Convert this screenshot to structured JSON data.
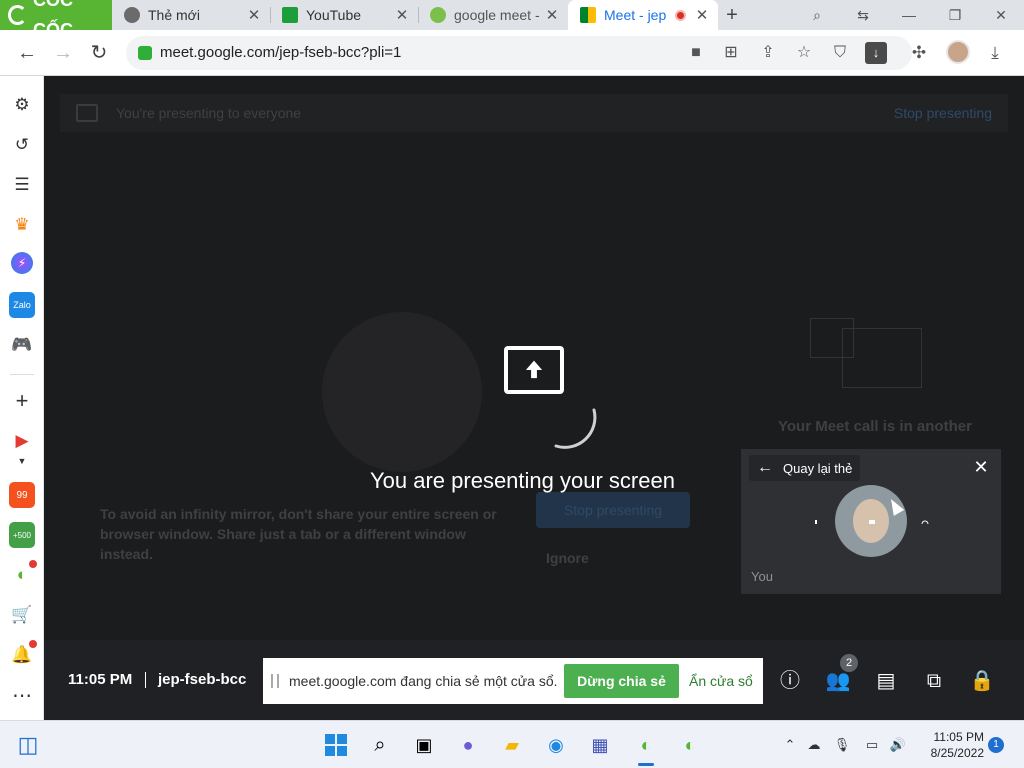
{
  "browser": {
    "brand": "CỐC CỐC",
    "tabs": [
      {
        "title": "Thẻ mới"
      },
      {
        "title": "YouTube"
      },
      {
        "title": "google meet -"
      },
      {
        "title": "Meet - jep",
        "active": true,
        "recording": true
      }
    ],
    "new_tab": "+",
    "url": "meet.google.com/jep-fseb-bcc?pli=1"
  },
  "meet": {
    "banner_text": "You're presenting to everyone",
    "banner_stop": "Stop presenting",
    "warning": "To avoid an infinity mirror, don't share your entire screen or browser window. Share just a tab or a different window instead.",
    "ghost_stop": "Stop presenting",
    "ghost_ignore": "Ignore",
    "ghost_call": "Your Meet call is in another",
    "presenting_title": "You are presenting your screen",
    "pip": {
      "back_label": "Quay lại thẻ",
      "self_label": "You"
    },
    "bottom": {
      "time": "11:05 PM",
      "code": "jep-fseb-bcc",
      "people_count": "2"
    },
    "share_notice": {
      "text": "meet.google.com đang chia sẻ một cửa sổ.",
      "stop_label": "Dừng chia sẻ",
      "hide_label": "Ẩn cửa sổ"
    }
  },
  "taskbar": {
    "time": "11:05 PM",
    "date": "8/25/2022",
    "notifications": "1"
  },
  "colors": {
    "brand_green": "#58b534",
    "share_green": "#4caf50",
    "meet_bg": "#1b1c1e",
    "meet_bar": "#202124",
    "record_red": "#d93025"
  }
}
